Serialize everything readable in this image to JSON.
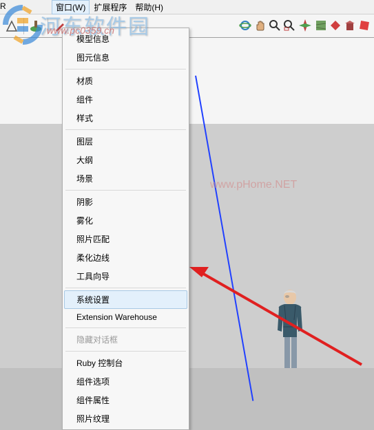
{
  "menubar": {
    "partial": "R",
    "window": "窗口(W)",
    "extension": "扩展程序",
    "help": "帮助(H)"
  },
  "dropdown": {
    "model_info": "模型信息",
    "entity_info": "图元信息",
    "materials": "材质",
    "components": "组件",
    "styles": "样式",
    "layers": "图层",
    "outliner": "大纲",
    "scenes": "场景",
    "shadows": "阴影",
    "fog": "雾化",
    "match_photo": "照片匹配",
    "soften_edges": "柔化边线",
    "instructor": "工具向导",
    "preferences": "系统设置",
    "extension_warehouse": "Extension Warehouse",
    "hide_dialogs": "隐藏对话框",
    "ruby_console": "Ruby 控制台",
    "component_options": "组件选项",
    "component_attributes": "组件属性",
    "photo_textures": "照片纹理"
  },
  "watermarks": {
    "site_name": "河东软件园",
    "site_url": "www.pc0359.cn",
    "ph_home": "www.pHome.NET"
  }
}
